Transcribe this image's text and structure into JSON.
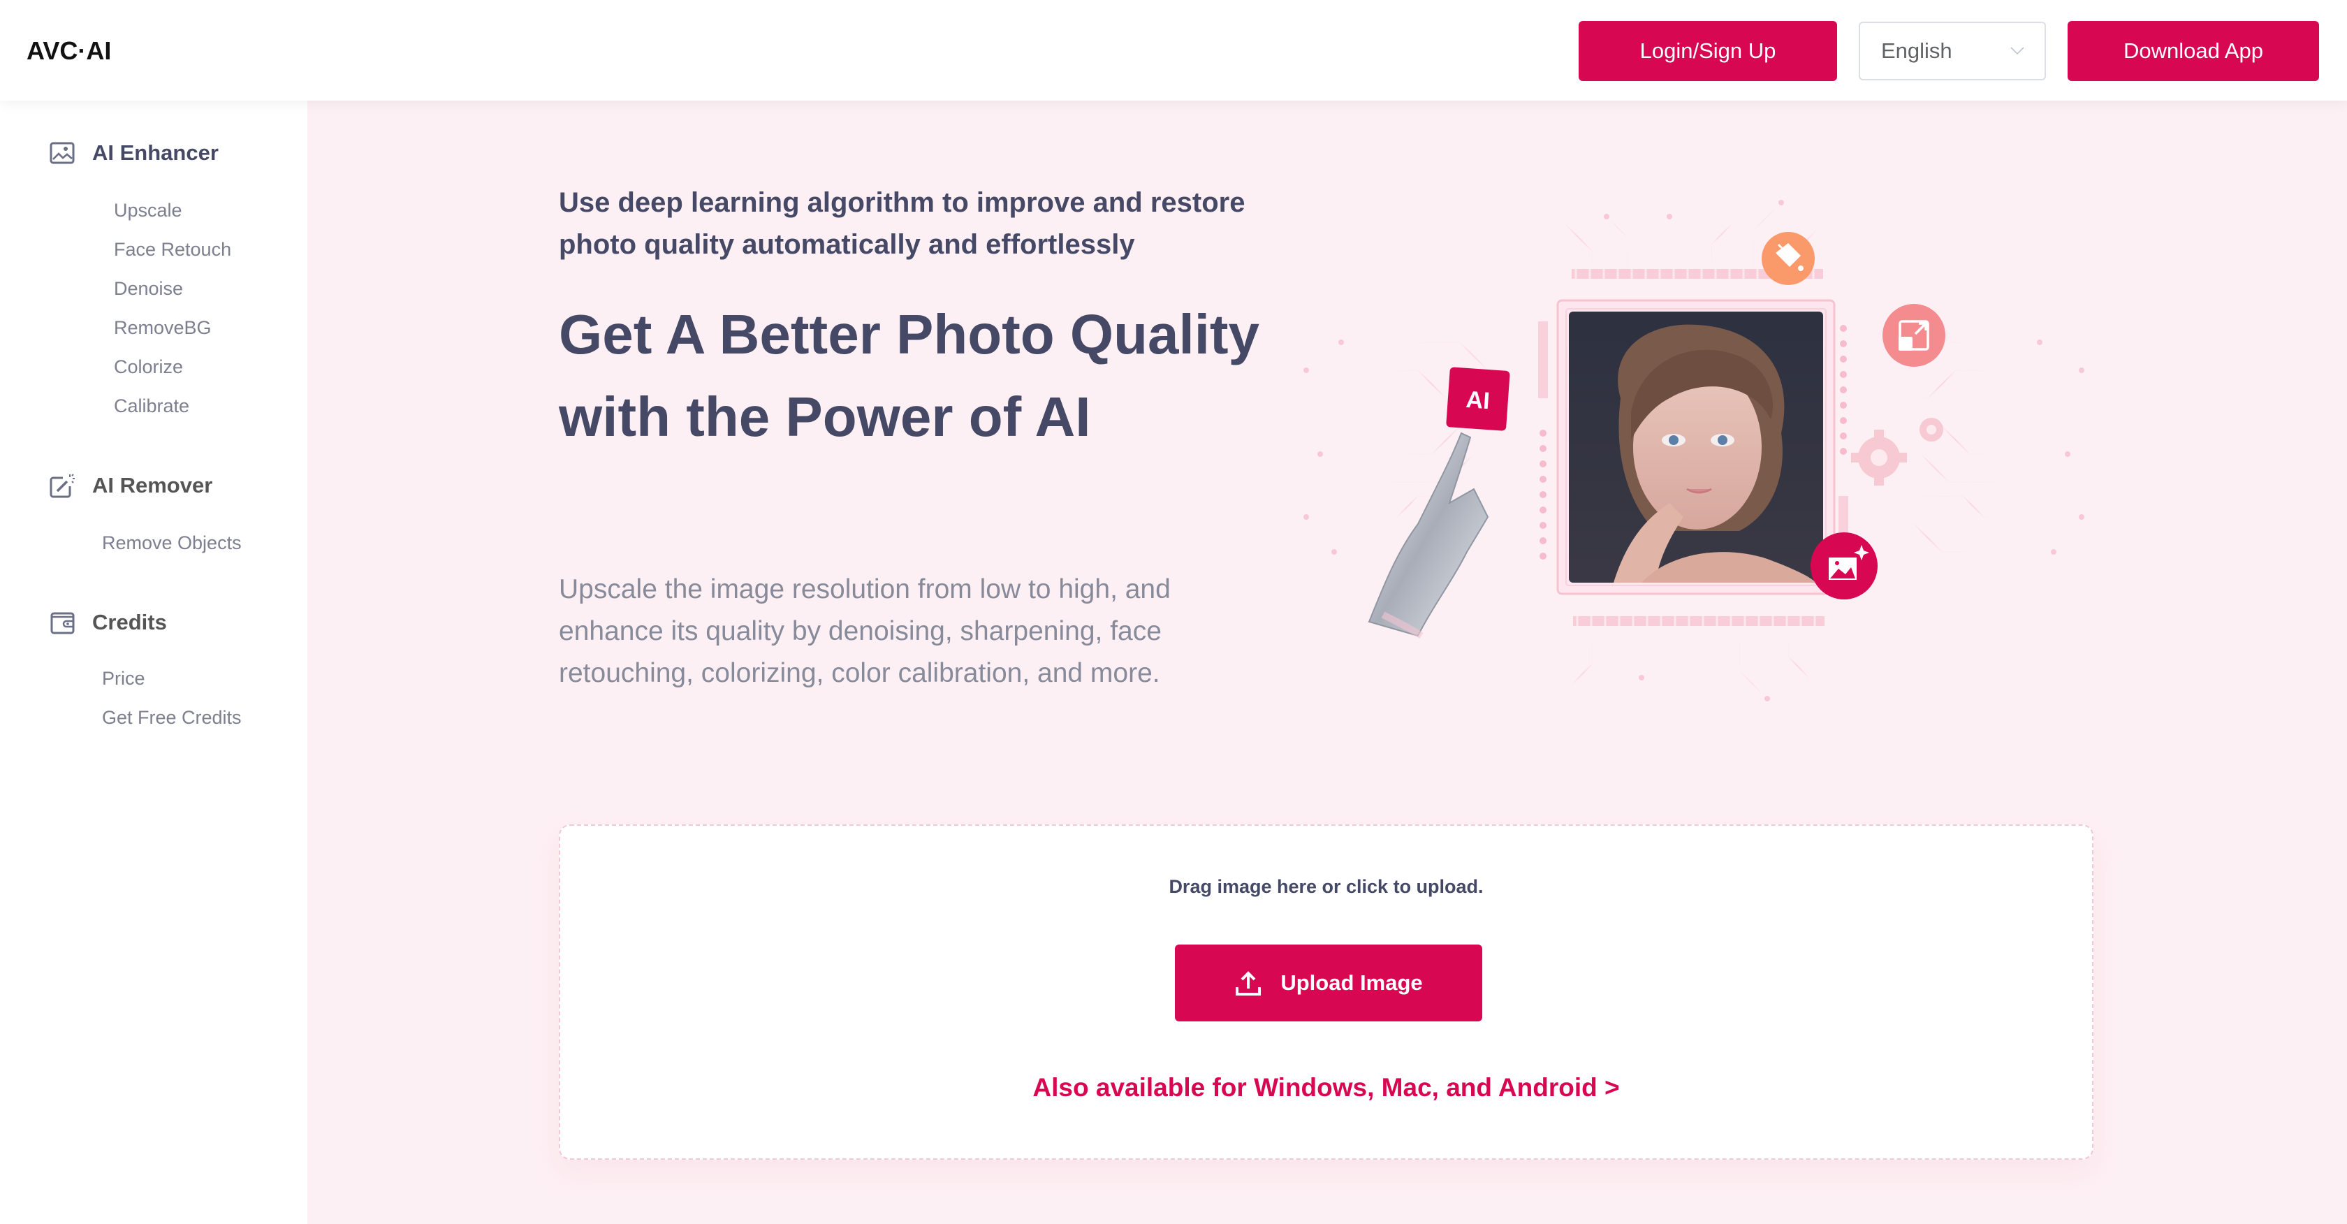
{
  "header": {
    "logo_text": "AVC·AI",
    "login_label": "Login/Sign Up",
    "language": {
      "selected": "English"
    },
    "download_label": "Download App"
  },
  "sidebar": {
    "groups": [
      {
        "title": "AI Enhancer",
        "icon": "image-icon",
        "active": true,
        "items": [
          "Upscale",
          "Face Retouch",
          "Denoise",
          "RemoveBG",
          "Colorize",
          "Calibrate"
        ]
      },
      {
        "title": "AI Remover",
        "icon": "magic-edit-icon",
        "active": false,
        "items": [
          "Remove Objects"
        ]
      },
      {
        "title": "Credits",
        "icon": "wallet-icon",
        "active": false,
        "items": [
          "Price",
          "Get Free Credits"
        ]
      }
    ]
  },
  "hero": {
    "subtitle": "Use deep learning algorithm to improve and restore photo quality automatically and effortlessly",
    "title": "Get A Better Photo Quality with the Power of AI",
    "description": "Upscale the image resolution from low to high, and enhance its quality by denoising, sharpening, face retouching, colorizing, color calibration, and more.",
    "illustration": {
      "badge_text": "AI",
      "icons": [
        "paint-bucket-icon",
        "resize-icon",
        "gear-icon",
        "image-sparkle-icon"
      ]
    }
  },
  "upload": {
    "drag_text": "Drag image here or click to upload.",
    "button_label": "Upload Image",
    "also_available": "Also available for Windows, Mac, and Android >"
  },
  "colors": {
    "brand": "#d70751",
    "page_background": "#fdf0f4",
    "heading_text": "#454966",
    "muted_text": "#878a99"
  }
}
